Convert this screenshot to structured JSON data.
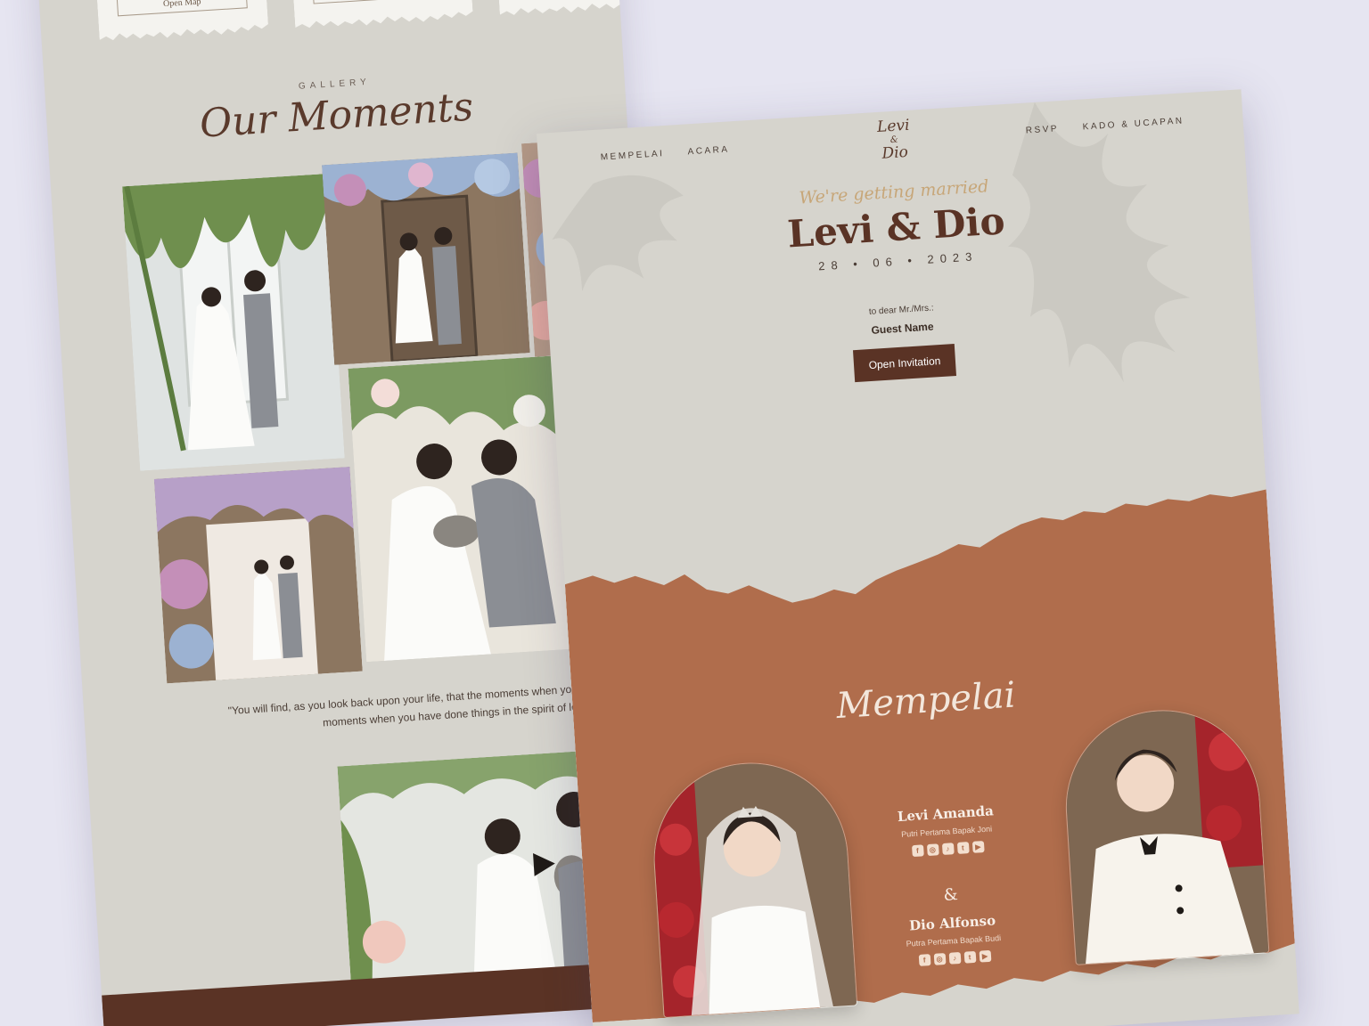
{
  "back_page": {
    "cards": [
      {
        "button_label": "Open Map"
      },
      {
        "button_label": ""
      },
      {
        "button_label": ""
      }
    ],
    "gallery": {
      "eyebrow": "GALLERY",
      "title": "Our Moments"
    },
    "quote": "\"You will find, as you look back upon your life, that the moments when you have truly lived are the moments when you have done things in the spirit of love.\"",
    "video": {
      "play_icon": "play-icon"
    }
  },
  "front_page": {
    "nav": {
      "left": [
        "MEMPELAI",
        "ACARA"
      ],
      "right": [
        "RSVP",
        "KADO & UCAPAN"
      ],
      "logo_line1": "Levi",
      "logo_amp": "&",
      "logo_line2": "Dio"
    },
    "hero": {
      "tagline": "We're getting married",
      "couple_names": "Levi & Dio",
      "date": "28 • 06 • 2023",
      "to_dear": "to dear Mr./Mrs.:",
      "guest_name": "Guest Name",
      "open_button": "Open Invitation"
    },
    "mempelai": {
      "title": "Mempelai",
      "ampersand": "&",
      "bride": {
        "name": "Levi Amanda",
        "subtitle": "Putri Pertama Bapak Joni",
        "socials": [
          "facebook-icon",
          "instagram-icon",
          "tiktok-icon",
          "twitter-icon",
          "youtube-icon"
        ]
      },
      "groom": {
        "name": "Dio Alfonso",
        "subtitle": "Putra Pertama Bapak Budi",
        "socials": [
          "facebook-icon",
          "instagram-icon",
          "tiktok-icon",
          "twitter-icon",
          "youtube-icon"
        ]
      }
    }
  },
  "colors": {
    "page_background": "#e6e5f1",
    "paper": "#d6d4cd",
    "accent_brown": "#5a3325",
    "terracotta": "#b06d4c",
    "gold": "#c7a678"
  }
}
